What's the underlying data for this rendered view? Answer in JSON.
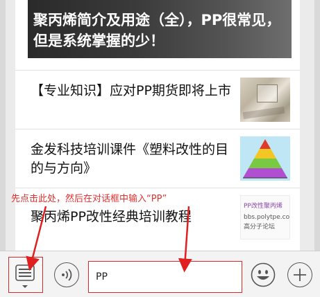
{
  "banner": {
    "title": "聚丙烯简介及用途（全），PP很常见，但是系统掌握的少！"
  },
  "articles": [
    {
      "title": "【专业知识】应对PP期货即将上市",
      "thumbnail": "sack-photo"
    },
    {
      "title": "金发科技培训课件《塑料改性的目的与方向》",
      "thumbnail": "pyramid-diagram"
    },
    {
      "title": "聚丙烯PP改性经典培训教程",
      "thumbnail": "text-card",
      "thumbnail_lines": [
        "PP改性聚丙烯",
        "bbs.polytpe.com",
        "高分子论坛"
      ]
    }
  ],
  "annotation": {
    "text": "先点击此处，然后在对话框中输入“PP”"
  },
  "input_bar": {
    "text_value": "PP",
    "menu_icon": "list-menu-icon",
    "voice_icon": "voice-icon",
    "emoji_icon": "smiley-icon",
    "plus_icon": "plus-icon"
  },
  "colors": {
    "annotation_red": "#d62a2a",
    "banner_dark": "#2a2a2a"
  }
}
